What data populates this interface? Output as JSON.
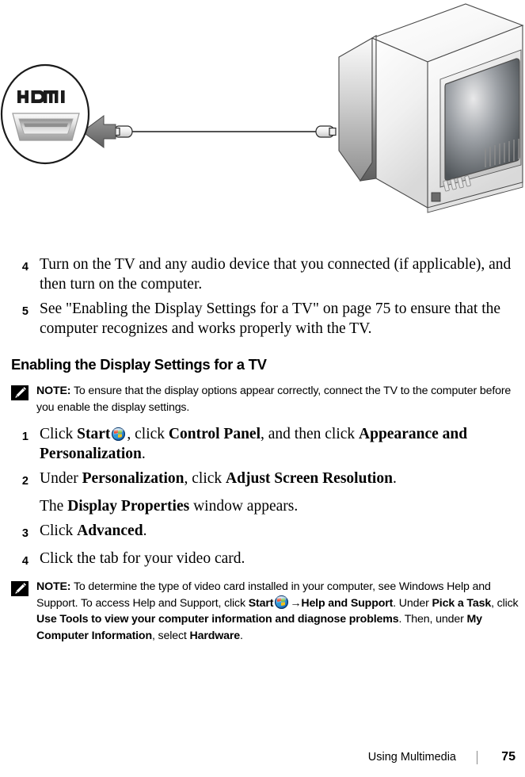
{
  "illustration": {
    "alt": "Connecting a computer HDMI port to a TV with an HDMI cable",
    "hdmi_logo_text": "HDMI",
    "callout_name": "hdmi-port-callout",
    "device_name": "television"
  },
  "steps_top": [
    {
      "num": "4",
      "html": "Turn on the TV and any audio device that you connected (if applicable), and then turn on the computer."
    },
    {
      "num": "5",
      "html": "See \"Enabling the Display Settings for a TV\" on page 75 to ensure that the computer recognizes and works properly with the TV."
    }
  ],
  "section": {
    "heading": "Enabling the Display Settings for a TV"
  },
  "note_1": {
    "label": "NOTE:",
    "text": "To ensure that the display options appear correctly, connect the TV to the computer before you enable the display settings."
  },
  "steps_bottom": [
    {
      "num": "1",
      "segments": [
        {
          "t": "text",
          "v": "Click "
        },
        {
          "t": "bold",
          "v": "Start"
        },
        {
          "t": "orb",
          "v": ""
        },
        {
          "t": "text",
          "v": ", click "
        },
        {
          "t": "bold",
          "v": "Control Panel"
        },
        {
          "t": "text",
          "v": ", and then click "
        },
        {
          "t": "bold",
          "v": "Appearance and Personalization"
        },
        {
          "t": "text",
          "v": "."
        }
      ]
    },
    {
      "num": "2",
      "segments": [
        {
          "t": "text",
          "v": "Under "
        },
        {
          "t": "bold",
          "v": "Personalization"
        },
        {
          "t": "text",
          "v": ", click "
        },
        {
          "t": "bold",
          "v": "Adjust Screen Resolution"
        },
        {
          "t": "text",
          "v": "."
        }
      ]
    }
  ],
  "sub_paragraph": {
    "segments": [
      {
        "t": "text",
        "v": "The "
      },
      {
        "t": "bold",
        "v": "Display Properties"
      },
      {
        "t": "text",
        "v": " window appears."
      }
    ]
  },
  "steps_bottom_2": [
    {
      "num": "3",
      "segments": [
        {
          "t": "text",
          "v": "Click "
        },
        {
          "t": "bold",
          "v": "Advanced"
        },
        {
          "t": "text",
          "v": "."
        }
      ]
    },
    {
      "num": "4",
      "segments": [
        {
          "t": "text",
          "v": "Click the tab for your video card."
        }
      ]
    }
  ],
  "note_2": {
    "label": "NOTE:",
    "segments": [
      {
        "t": "text",
        "v": "To determine the type of video card installed in your computer, see Windows Help and Support. To access Help and Support, click "
      },
      {
        "t": "bold",
        "v": "Start"
      },
      {
        "t": "orb",
        "v": ""
      },
      {
        "t": "bold",
        "v": "→Help and Support"
      },
      {
        "t": "text",
        "v": ". Under "
      },
      {
        "t": "bold",
        "v": "Pick a Task"
      },
      {
        "t": "text",
        "v": ", click "
      },
      {
        "t": "bold",
        "v": "Use Tools to view your computer information and diagnose problems"
      },
      {
        "t": "text",
        "v": ". Then, under "
      },
      {
        "t": "bold",
        "v": "My Computer Information"
      },
      {
        "t": "text",
        "v": ", select "
      },
      {
        "t": "bold",
        "v": "Hardware"
      },
      {
        "t": "text",
        "v": "."
      }
    ]
  },
  "footer": {
    "title": "Using Multimedia",
    "page": "75",
    "separator": "|"
  },
  "colors": {
    "text": "#000000",
    "note_icon_bg": "#000000",
    "tv_body_light": "#f4f4f4",
    "tv_body_dark": "#6e6e6e",
    "screen_dark": "#5a5d61",
    "arrow_gray": "#7b7b7b",
    "footer_rule": "#8a8a8a"
  }
}
